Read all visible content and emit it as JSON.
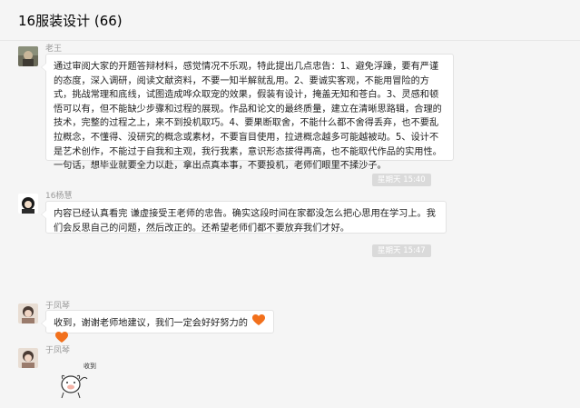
{
  "header": {
    "title": "16服装设计 (66)"
  },
  "messages": [
    {
      "sender": "老王",
      "text": "通过审阅大家的开题答辩材料，感觉情况不乐观，特此提出几点忠告：1、避免浮躁，要有严谨的态度，深入调研，阅读文献资料，不要一知半解就乱用。2、要诚实客观，不能用冒险的方式，挑战常理和底线，试图造成哗众取宠的效果，假装有设计，掩盖无知和苍白。3、灵感和顿悟可以有，但不能缺少步骤和过程的展现。作品和论文的最终质量，建立在清晰思路辑，合理的技术，完整的过程之上，来不到投机取巧。4、要果断取舍，不能什么都不舍得丢弃，也不要乱拉概念，不懂得、没研究的概念或素材，不要盲目使用，拉进概念越多可能越被动。5、设计不是艺术创作，不能过于自我和主观，我行我素，意识形态拔得再高，也不能取代作品的实用性。一句话，想毕业就要全力以赴，拿出点真本事，不要投机，老师们眼里不揉沙子。"
    },
    {
      "time": "星期天 15:40"
    },
    {
      "sender": "16杨慧",
      "text": "内容已经认真看完 谦虚接受王老师的忠告。确实这段时间在家都没怎么把心思用在学习上。我们会反思自己的问题，然后改正的。还希望老师们都不要放弃我们才好。"
    },
    {
      "time": "星期天 15:47"
    },
    {
      "sender": "于凤琴",
      "text": "收到，谢谢老师地建议，我们一定会好好努力的",
      "emoji": [
        "heart-emoji",
        "heart-emoji"
      ]
    },
    {
      "sender": "于凤琴",
      "sticker": {
        "caption": "收到",
        "icon": "bear-sticker"
      }
    }
  ]
}
